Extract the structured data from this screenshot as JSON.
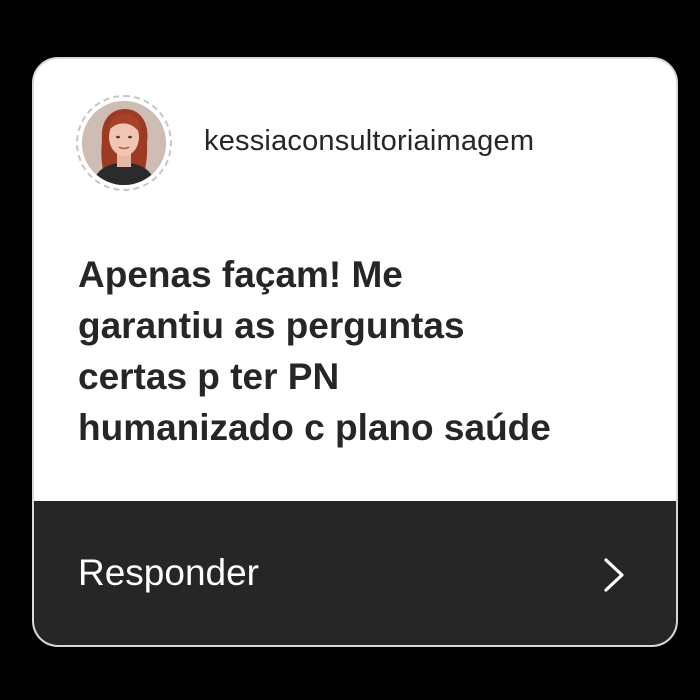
{
  "story_reply_card": {
    "username": "kessiaconsultoriaimagem",
    "avatar": "profile-photo",
    "message_lines": [
      "Apenas façam! Me",
      "garantiu as perguntas",
      "certas p ter PN",
      "humanizado c plano saúde"
    ],
    "reply_label": "Responder",
    "reply_icon": "chevron-right-icon"
  },
  "colors": {
    "background": "#000000",
    "card": "#ffffff",
    "text": "#262626",
    "reply_bar": "#262626",
    "reply_text": "#ffffff"
  }
}
